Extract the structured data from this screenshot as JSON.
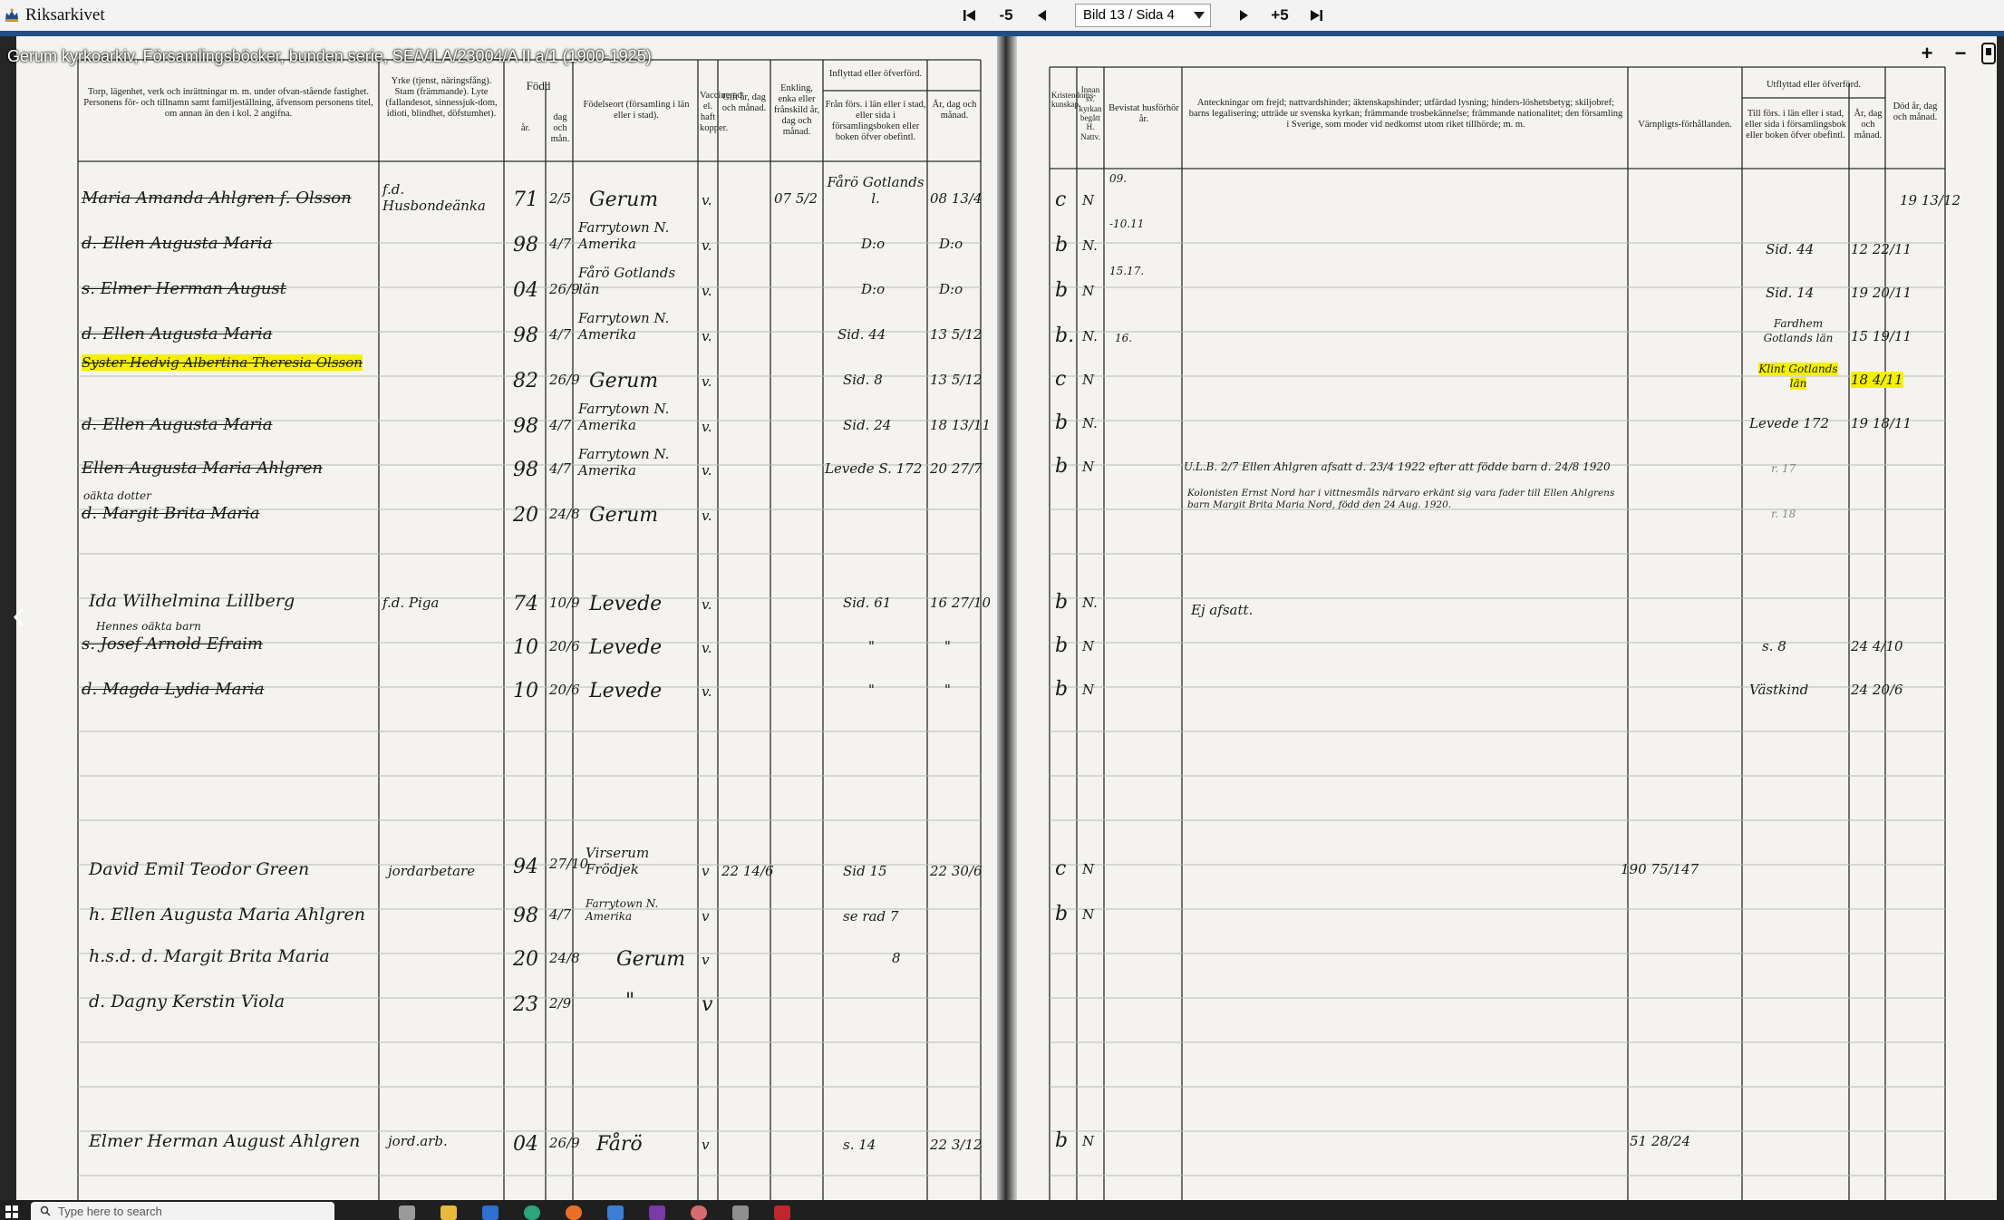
{
  "app": {
    "name": "Riksarkivet",
    "crown_icon": "crown-icon"
  },
  "pager": {
    "first_icon": "first-page-icon",
    "back5_label": "-5",
    "prev_icon": "prev-page-icon",
    "current": "Bild 13 / Sida 4",
    "next_icon": "next-page-icon",
    "fwd5_label": "+5",
    "last_icon": "last-page-icon"
  },
  "document": {
    "title": "Gerum kyrkoarkiv, Församlingsböcker, bunden serie, SE/ViLA/23004/A II a/1 (1900-1925)"
  },
  "viewer_controls": {
    "zoom_in": "+",
    "zoom_out": "−"
  },
  "ledger": {
    "left_headers": {
      "c1": "Torp, lägenhet, verk och inrättningar m. m. under ofvan-stående fastighet. Personens för- och tillnamn samt familjeställning, äfvensom personens titel, om annan än den i kol. 2 angifna.",
      "c2": "Yrke (tjenst, näringsfång). Stam (främmande). Lyte (fallandesot, sinnessjuk-dom, idioti, blindhet, döfstumhet).",
      "c3": "Född",
      "c3a": "år.",
      "c3b": "dag och mån.",
      "c5": "Födelseort (församling i län eller i stad).",
      "c6": "Vaccinerad el. haft kopper.",
      "c7": "Gift år, dag och månad.",
      "c8": "Enkling, enka eller frånskild år, dag och månad.",
      "c9": "Inflyttad eller öfverförd.",
      "c9a": "Från förs. i län eller i stad, eller sida i församlingsboken eller boken öfver obefintl.",
      "c10": "År, dag och månad."
    },
    "right_headers": {
      "c11": "Kristendoms-kunskap.",
      "c12": "Innan sv. kyrkan begått H. Nattv.",
      "c13": "Bevistat husförhör år.",
      "c14": "Anteckningar om frejd; nattvardshinder; äktenskapshinder; utfärdad lysning; hinders-löshetsbetyg; skiljobref; barns legalisering; utträde ur svenska kyrkan; främmande trosbekännelse; främmande nationalitet; den församling i Sverige, som moder vid nedkomst utom riket tillhörde; m. m.",
      "c15": "Värnpligts-förhållanden.",
      "c16": "Utflyttad eller öfverförd.",
      "c16a": "Till förs. i län eller i stad, eller sida i församlingsbok eller boken öfver obefintl.",
      "c17": "År, dag och månad.",
      "c18": "Död år, dag och månad."
    },
    "left_entries": [
      {
        "name": "Maria Amanda Ahlgren f. Olsson",
        "trade": "f.d. Husbondeänka",
        "year": "71",
        "day": "2/5",
        "place": "Gerum",
        "vacc": "v.",
        "married": "07 5/2",
        "from": "Fårö Gotlands l.",
        "moved_in": "08 13/4"
      },
      {
        "name": "d. Ellen Augusta Maria",
        "year": "98",
        "day": "4/7",
        "place": "Farrytown N. Amerika",
        "vacc": "v.",
        "from": "D:o",
        "moved_in": "D:o"
      },
      {
        "name": "s. Elmer Herman August",
        "year": "04",
        "day": "26/9",
        "place": "Fårö Gotlands län",
        "vacc": "v.",
        "from": "D:o",
        "moved_in": "D:o"
      },
      {
        "name": "d. Ellen Augusta Maria",
        "year": "98",
        "day": "4/7",
        "place": "Farrytown N. Amerika",
        "vacc": "v.",
        "from": "Sid. 44",
        "moved_in": "13 5/12"
      },
      {
        "name": "Syster Hedvig Albertina Theresia Olsson",
        "year": "82",
        "day": "26/9",
        "place": "Gerum",
        "vacc": "v.",
        "from": "Sid. 8",
        "moved_in": "13 5/12"
      },
      {
        "name": "d. Ellen Augusta Maria",
        "year": "98",
        "day": "4/7",
        "place": "Farrytown N. Amerika",
        "vacc": "v.",
        "from": "Sid. 24",
        "moved_in": "18 13/11"
      },
      {
        "name": "Ellen Augusta Maria Ahlgren",
        "year": "98",
        "day": "4/7",
        "place": "Farrytown N. Amerika",
        "vacc": "v.",
        "from": "Levede S. 172",
        "moved_in": "20 27/7"
      },
      {
        "name": "d. Margit Brita Maria",
        "note": "oäkta dotter",
        "year": "20",
        "day": "24/8",
        "place": "Gerum",
        "vacc": "v."
      },
      {
        "name": "Ida Wilhelmina Lillberg",
        "trade": "f.d. Piga",
        "year": "74",
        "day": "10/9",
        "place": "Levede",
        "vacc": "v.",
        "from": "Sid. 61",
        "moved_in": "16 27/10"
      },
      {
        "name": "s. Josef Arnold Efraim",
        "note": "Hennes oäkta barn",
        "year": "10",
        "day": "20/6",
        "place": "Levede",
        "vacc": "v.",
        "from": "\"",
        "moved_in": "\""
      },
      {
        "name": "d. Magda Lydia Maria",
        "year": "10",
        "day": "20/6",
        "place": "Levede",
        "vacc": "v.",
        "from": "\"",
        "moved_in": "\""
      },
      {
        "name": "David Emil Teodor Green",
        "trade": "jordarbetare",
        "year": "94",
        "day": "27/10",
        "place": "Virserum Frödjek",
        "vacc": "v",
        "married": "22 14/6",
        "from": "Sid 15",
        "moved_in": "22 30/6"
      },
      {
        "name": "h. Ellen Augusta Maria Ahlgren",
        "year": "98",
        "day": "4/7",
        "place": "Farrytown N. Amerika",
        "vacc": "v",
        "from": "se rad 7"
      },
      {
        "name": "h.s.d. d. Margit Brita Maria",
        "year": "20",
        "day": "24/8",
        "place": "Gerum",
        "vacc": "v",
        "moved_in": "8"
      },
      {
        "name": "d. Dagny Kerstin Viola",
        "year": "23",
        "day": "2/9",
        "place": "\"",
        "vacc": "v"
      },
      {
        "name": "Elmer Herman August Ahlgren",
        "trade": "jord.arb.",
        "year": "04",
        "day": "26/9",
        "place": "Fårö",
        "vacc": "v",
        "from": "s. 14",
        "moved_in": "22 3/12"
      }
    ],
    "right_entries": [
      {
        "kr": "c",
        "nv": "N",
        "hf": "09.",
        "death": "19 13/12"
      },
      {
        "kr": "b",
        "nv": "N.",
        "hf": "-10.11",
        "to": "Sid. 44",
        "out": "12 22/11"
      },
      {
        "kr": "b",
        "nv": "N",
        "hf": "15.17.",
        "to": "Sid. 14",
        "out": "19 20/11"
      },
      {
        "kr": "b.",
        "nv": "N.",
        "hf": "16.",
        "to": "Fardhem Gotlands län",
        "out": "15 19/11"
      },
      {
        "kr": "c",
        "nv": "N",
        "to": "Klint Gotlands län",
        "out": "18 4/11"
      },
      {
        "kr": "b",
        "nv": "N.",
        "to": "Levede 172",
        "out": "19 18/11"
      },
      {
        "kr": "b",
        "nv": "N",
        "note": "U.L.B. 2/7 Ellen Ahlgren afsatt d. 23/4 1922 efter att födde barn d. 24/8 1920",
        "to": "r. 17"
      },
      {
        "note": "Kolonisten Ernst Nord har i vittnesmåls närvaro erkänt sig vara fader till Ellen Ahlgrens barn Margit Brita Maria Nord, född den 24 Aug. 1920.",
        "to": "r. 18"
      },
      {
        "kr": "b",
        "nv": "N.",
        "note": "Ej afsatt."
      },
      {
        "kr": "b",
        "nv": "N",
        "to": "s. 8",
        "out": "24 4/10"
      },
      {
        "kr": "b",
        "nv": "N",
        "to": "Västkind",
        "out": "24 20/6"
      },
      {
        "kr": "c",
        "nv": "N",
        "mil": "190 75/147"
      },
      {
        "kr": "b",
        "nv": "N"
      },
      {
        "kr": "b",
        "nv": "N",
        "mil": "51 28/24"
      }
    ]
  },
  "taskbar": {
    "search_placeholder": "Type here to search"
  }
}
